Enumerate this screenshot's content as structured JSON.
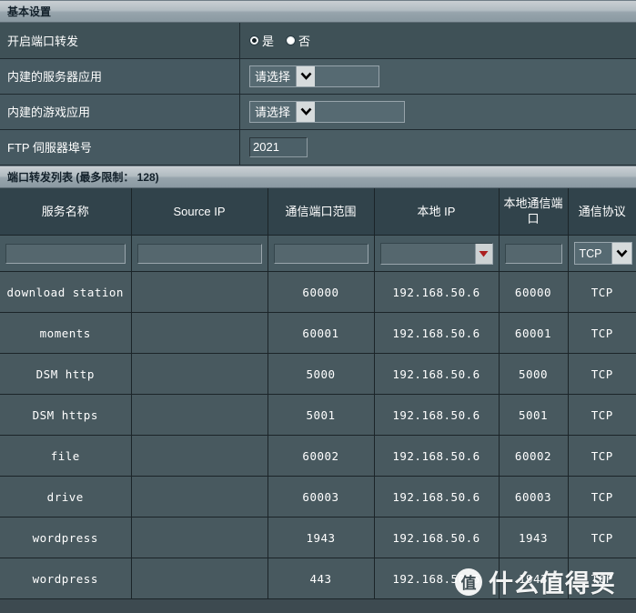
{
  "basic": {
    "section_title": "基本设置",
    "rows": [
      {
        "label": "开启端口转发",
        "type": "radio"
      },
      {
        "label": "内建的服务器应用",
        "type": "select",
        "value": "请选择"
      },
      {
        "label": "内建的游戏应用",
        "type": "select",
        "value": "请选择"
      },
      {
        "label": "FTP 伺服器埠号",
        "type": "input",
        "value": "2021"
      }
    ],
    "radio_options": [
      {
        "label": "是",
        "selected": true
      },
      {
        "label": "否",
        "selected": false
      }
    ]
  },
  "forwarding": {
    "section_title": "端口转发列表 (最多限制： 128)",
    "columns": [
      "服务名称",
      "Source IP",
      "通信端口范围",
      "本地 IP",
      "本地通信端口",
      "通信协议"
    ],
    "new_row": {
      "service_name": "",
      "source_ip": "",
      "port_range": "",
      "local_ip": "",
      "local_port": "",
      "protocol": "TCP"
    },
    "rows": [
      {
        "service_name": "download station",
        "source_ip": "",
        "port_range": "60000",
        "local_ip": "192.168.50.6",
        "local_port": "60000",
        "protocol": "TCP"
      },
      {
        "service_name": "moments",
        "source_ip": "",
        "port_range": "60001",
        "local_ip": "192.168.50.6",
        "local_port": "60001",
        "protocol": "TCP"
      },
      {
        "service_name": "DSM http",
        "source_ip": "",
        "port_range": "5000",
        "local_ip": "192.168.50.6",
        "local_port": "5000",
        "protocol": "TCP"
      },
      {
        "service_name": "DSM https",
        "source_ip": "",
        "port_range": "5001",
        "local_ip": "192.168.50.6",
        "local_port": "5001",
        "protocol": "TCP"
      },
      {
        "service_name": "file",
        "source_ip": "",
        "port_range": "60002",
        "local_ip": "192.168.50.6",
        "local_port": "60002",
        "protocol": "TCP"
      },
      {
        "service_name": "drive",
        "source_ip": "",
        "port_range": "60003",
        "local_ip": "192.168.50.6",
        "local_port": "60003",
        "protocol": "TCP"
      },
      {
        "service_name": "wordpress",
        "source_ip": "",
        "port_range": "1943",
        "local_ip": "192.168.50.6",
        "local_port": "1943",
        "protocol": "TCP"
      },
      {
        "service_name": "wordpress",
        "source_ip": "",
        "port_range": "443",
        "local_ip": "192.168.50.6",
        "local_port": "1943",
        "protocol": "TCP"
      }
    ]
  },
  "watermark": {
    "badge": "值",
    "text": "什么值得买"
  },
  "colors": {
    "page_bg": "#3d4a50",
    "header_bar": "#b2bcc2",
    "row_label_bg": "#465961",
    "row_value_bg": "#4a5d64",
    "table_header_bg": "#31434b",
    "data_row_bg": "#48595f",
    "grid_line": "#1b2428",
    "text": "#ffffff",
    "combo_arrow": "#b02020"
  }
}
